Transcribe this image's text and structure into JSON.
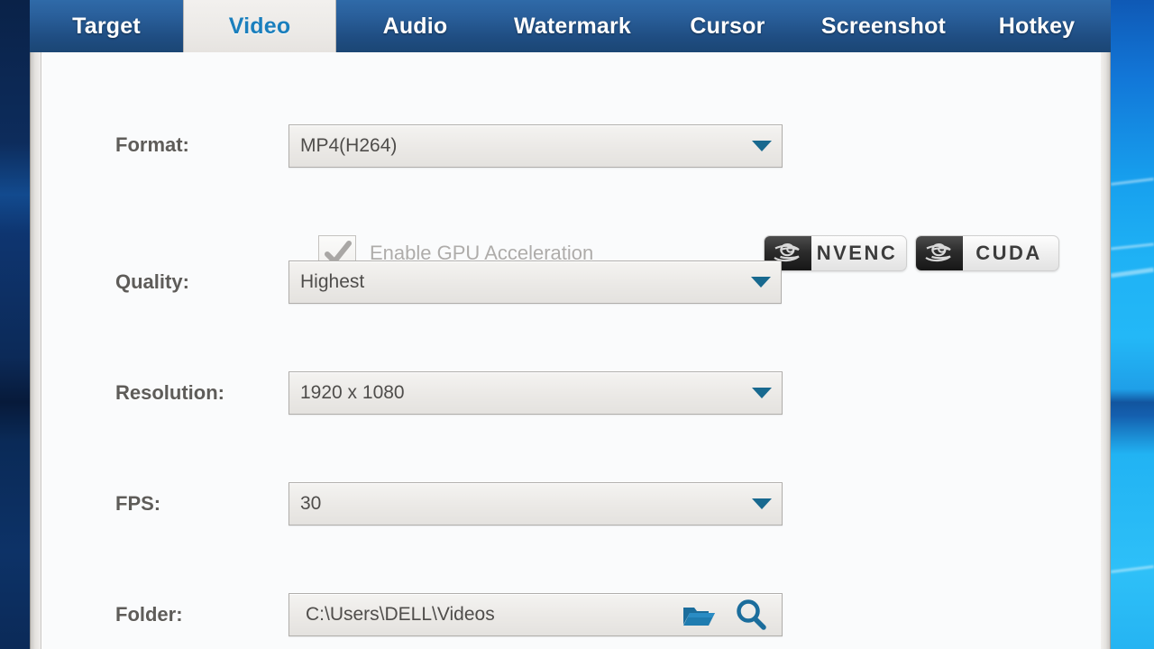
{
  "window": {
    "tabs": [
      {
        "label": "Target",
        "active": false
      },
      {
        "label": "Video",
        "active": true
      },
      {
        "label": "Audio",
        "active": false
      },
      {
        "label": "Watermark",
        "active": false
      },
      {
        "label": "Cursor",
        "active": false
      },
      {
        "label": "Screenshot",
        "active": false
      },
      {
        "label": "Hotkey",
        "active": false
      }
    ]
  },
  "video_settings": {
    "format": {
      "label": "Format:",
      "value": "MP4(H264)"
    },
    "gpu": {
      "checkbox_label": "Enable GPU Acceleration",
      "checked": true,
      "disabled": true,
      "badges": [
        {
          "name": "NVENC",
          "icon": "nvidia-logo-icon"
        },
        {
          "name": "CUDA",
          "icon": "nvidia-logo-icon"
        }
      ]
    },
    "quality": {
      "label": "Quality:",
      "value": "Highest"
    },
    "resolution": {
      "label": "Resolution:",
      "value": "1920 x 1080"
    },
    "fps": {
      "label": "FPS:",
      "value": "30"
    },
    "folder": {
      "label": "Folder:",
      "value": "C:\\Users\\DELL\\Videos",
      "open_folder_icon": "folder-icon",
      "browse_icon": "search-icon"
    }
  },
  "colors": {
    "tab_active_text": "#1a7fbd",
    "tab_bar": "#245585",
    "caret": "#18698f",
    "label_text": "#5e5c59",
    "folder_icon": "#1a6f9e",
    "desktop_left": "#0c2f5e",
    "desktop_right": "#21b3f3"
  }
}
